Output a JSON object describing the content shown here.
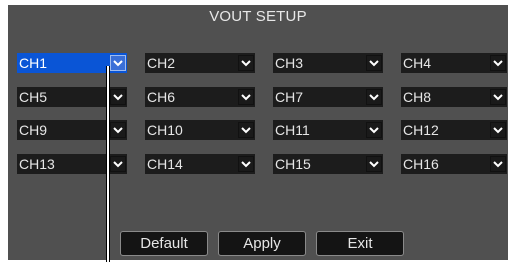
{
  "title": "VOUT SETUP",
  "channels": [
    {
      "label": "CH1",
      "selected": true
    },
    {
      "label": "CH2"
    },
    {
      "label": "CH3"
    },
    {
      "label": "CH4"
    },
    {
      "label": "CH5"
    },
    {
      "label": "CH6"
    },
    {
      "label": "CH7"
    },
    {
      "label": "CH8"
    },
    {
      "label": "CH9"
    },
    {
      "label": "CH10"
    },
    {
      "label": "CH11"
    },
    {
      "label": "CH12"
    },
    {
      "label": "CH13"
    },
    {
      "label": "CH14"
    },
    {
      "label": "CH15"
    },
    {
      "label": "CH16"
    }
  ],
  "buttons": {
    "default": "Default",
    "apply": "Apply",
    "exit": "Exit"
  },
  "icons": {
    "dropdown": "chevron-down-icon"
  },
  "colors": {
    "panel": "#505050",
    "field": "#1c1c1c",
    "selected": "#0a55d6",
    "text": "#e6e6e6"
  }
}
